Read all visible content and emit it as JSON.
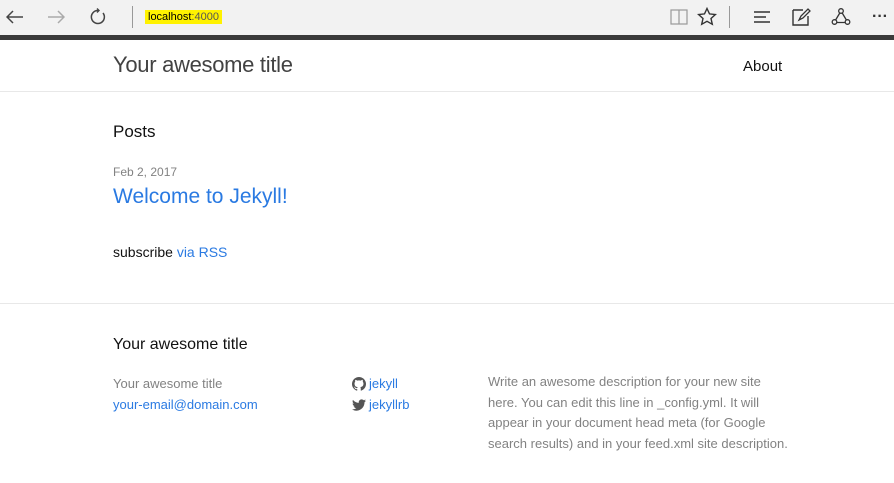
{
  "browser": {
    "url_host": "localhost",
    "url_port": ":4000",
    "icons": [
      "back-arrow-icon",
      "forward-arrow-icon",
      "refresh-icon",
      "reading-view-icon",
      "favorite-star-icon",
      "hub-icon",
      "web-note-icon",
      "share-icon",
      "more-icon"
    ],
    "more_label": "···"
  },
  "header": {
    "site_title": "Your awesome title",
    "nav_about": "About"
  },
  "main": {
    "posts_heading": "Posts",
    "posts": [
      {
        "date": "Feb 2, 2017",
        "title": "Welcome to Jekyll!"
      }
    ],
    "subscribe_text": "subscribe",
    "rss_link": "via RSS"
  },
  "footer": {
    "title": "Your awesome title",
    "name": "Your awesome title",
    "email": "your-email@domain.com",
    "github": "jekyll",
    "twitter": "jekyllrb",
    "description": "Write an awesome description for your new site here. You can edit this line in _config.yml. It will appear in your document head meta (for Google search results) and in your feed.xml site description."
  },
  "colors": {
    "link": "#2a7ae2",
    "url_highlight": "#fff200",
    "muted": "#828282"
  }
}
